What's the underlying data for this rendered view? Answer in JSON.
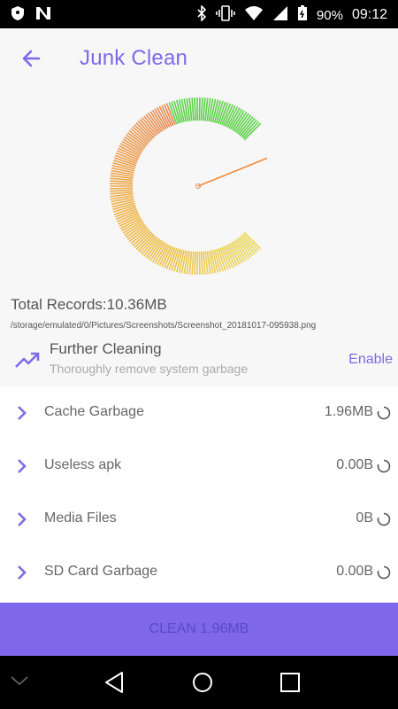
{
  "status_bar": {
    "battery": "90%",
    "time": "09:12",
    "icons": [
      "shield-icon",
      "n-icon",
      "bluetooth-icon",
      "vibrate-icon",
      "wifi-icon",
      "signal-icon",
      "battery-icon"
    ]
  },
  "header": {
    "title": "Junk Clean",
    "back_icon": "arrow-left-icon"
  },
  "gauge": {
    "needle_angle_deg": 68
  },
  "summary": {
    "total_records": "Total Records:10.36MB",
    "path": "/storage/emulated/0/Pictures/Screenshots/Screenshot_20181017-095938.png"
  },
  "further": {
    "title": "Further Cleaning",
    "subtitle": "Thoroughly remove system garbage",
    "action": "Enable"
  },
  "items": [
    {
      "label": "Cache Garbage",
      "size": "1.96MB"
    },
    {
      "label": "Useless apk",
      "size": "0.00B"
    },
    {
      "label": "Media Files",
      "size": "0B"
    },
    {
      "label": "SD Card Garbage",
      "size": "0.00B"
    }
  ],
  "clean_button": "CLEAN 1.96MB",
  "colors": {
    "accent": "#7d6ae8",
    "button_bg": "#7e67ea",
    "gauge_start": "#e8d95a",
    "gauge_mid": "#e58a55",
    "gauge_end": "#5ed04a",
    "needle": "#f08a3a"
  }
}
